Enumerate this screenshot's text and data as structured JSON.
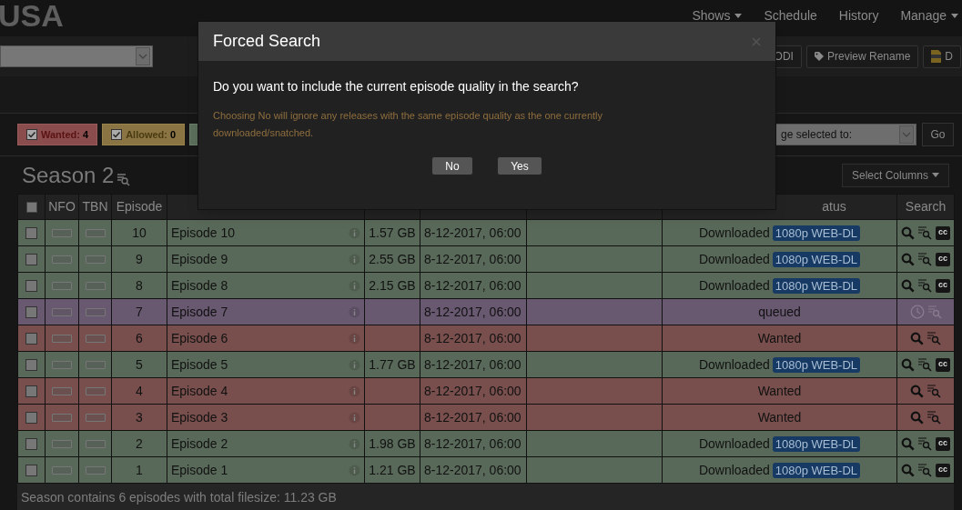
{
  "logo": {
    "text": "USA"
  },
  "nav": [
    {
      "label": "Shows",
      "dropdown": true
    },
    {
      "label": "Schedule",
      "dropdown": false
    },
    {
      "label": "History",
      "dropdown": false
    },
    {
      "label": "Manage",
      "dropdown": true
    }
  ],
  "toolbar": {
    "buttons": [
      {
        "label": "ODI",
        "kind": "plain"
      },
      {
        "label": "Preview Rename",
        "kind": "tag"
      },
      {
        "label": "D",
        "kind": "srt"
      }
    ]
  },
  "filters": [
    {
      "label": "Wanted:",
      "count": "4",
      "checked": true,
      "kind": "wanted"
    },
    {
      "label": "Allowed:",
      "count": "0",
      "checked": true,
      "kind": "allowed"
    },
    {
      "kind": "downloaded"
    }
  ],
  "bulk": {
    "select_text": "ge selected to:",
    "go": "Go"
  },
  "season": {
    "title": "Season 2",
    "select_columns": "Select Columns"
  },
  "table": {
    "columns": [
      {
        "kind": "check",
        "checked": false
      },
      {
        "label": "NFO"
      },
      {
        "label": "TBN"
      },
      {
        "label": "Episode"
      },
      {},
      {},
      {},
      {},
      {
        "label": "atus"
      },
      {
        "label": "Search"
      }
    ],
    "rows": [
      {
        "kind": "downloaded",
        "checked": false,
        "episode": "10",
        "name": "Episode 10",
        "size": "1.57 GB",
        "airdate": "8-12-2017, 06:00",
        "status": "Downloaded",
        "quality": "1080p WEB-DL",
        "subtitles_icon": "cc"
      },
      {
        "kind": "downloaded",
        "checked": false,
        "episode": "9",
        "name": "Episode 9",
        "size": "2.55 GB",
        "airdate": "8-12-2017, 06:00",
        "status": "Downloaded",
        "quality": "1080p WEB-DL",
        "subtitles_icon": "cc"
      },
      {
        "kind": "downloaded",
        "checked": false,
        "episode": "8",
        "name": "Episode 8",
        "size": "2.15 GB",
        "airdate": "8-12-2017, 06:00",
        "status": "Downloaded",
        "quality": "1080p WEB-DL",
        "subtitles_icon": "cc"
      },
      {
        "kind": "queued",
        "checked": false,
        "episode": "7",
        "name": "Episode 7",
        "airdate": "8-12-2017, 06:00",
        "status": "queued"
      },
      {
        "kind": "wanted",
        "checked": false,
        "episode": "6",
        "name": "Episode 6",
        "airdate": "8-12-2017, 06:00",
        "status": "Wanted"
      },
      {
        "kind": "downloaded",
        "checked": false,
        "episode": "5",
        "name": "Episode 5",
        "size": "1.77 GB",
        "airdate": "8-12-2017, 06:00",
        "status": "Downloaded",
        "quality": "1080p WEB-DL",
        "subtitles_icon": "cc"
      },
      {
        "kind": "wanted",
        "checked": false,
        "episode": "4",
        "name": "Episode 4",
        "airdate": "8-12-2017, 06:00",
        "status": "Wanted"
      },
      {
        "kind": "wanted",
        "checked": false,
        "episode": "3",
        "name": "Episode 3",
        "airdate": "8-12-2017, 06:00",
        "status": "Wanted"
      },
      {
        "kind": "downloaded",
        "checked": false,
        "episode": "2",
        "name": "Episode 2",
        "size": "1.98 GB",
        "airdate": "8-12-2017, 06:00",
        "status": "Downloaded",
        "quality": "1080p WEB-DL",
        "subtitles_icon": "cc"
      },
      {
        "kind": "downloaded",
        "checked": false,
        "episode": "1",
        "name": "Episode 1",
        "size": "1.21 GB",
        "airdate": "8-12-2017, 06:00",
        "status": "Downloaded",
        "quality": "1080p WEB-DL",
        "subtitles_icon": "cc"
      }
    ],
    "footer": "Season contains 6 episodes with total filesize: 11.23 GB"
  },
  "dialog": {
    "title": "Forced Search",
    "question": "Do you want to include the current episode quality in the search?",
    "hint": "Choosing No will ignore any releases with the same episode quality as the one currently downloaded/snatched.",
    "buttons": [
      "No",
      "Yes"
    ]
  }
}
